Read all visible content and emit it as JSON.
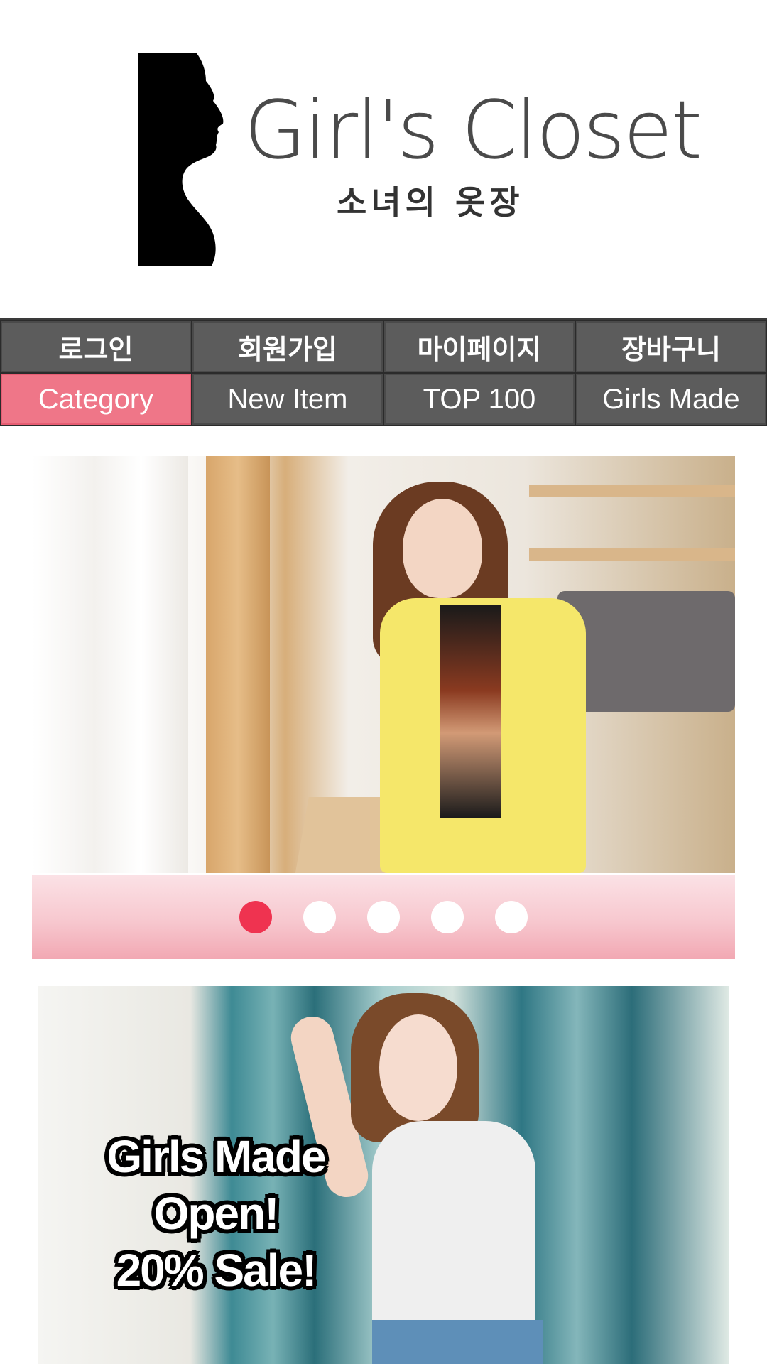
{
  "logo": {
    "title_en": "Girl's Closet",
    "title_ko": "소녀의 옷장",
    "icon": "woman-silhouette-icon"
  },
  "nav": {
    "row1": [
      {
        "label": "로그인"
      },
      {
        "label": "회원가입"
      },
      {
        "label": "마이페이지"
      },
      {
        "label": "장바구니"
      }
    ],
    "row2": [
      {
        "label": "Category",
        "active": true
      },
      {
        "label": "New Item"
      },
      {
        "label": "TOP 100"
      },
      {
        "label": "Girls Made"
      }
    ]
  },
  "slider": {
    "total_slides": 5,
    "current_index": 1
  },
  "promo": {
    "line1": "Girls Made",
    "line2": "Open!",
    "line3": "20% Sale!"
  },
  "colors": {
    "accent": "#ef7688",
    "active_dot": "#ef3350",
    "nav_button": "#5c5c5c"
  }
}
